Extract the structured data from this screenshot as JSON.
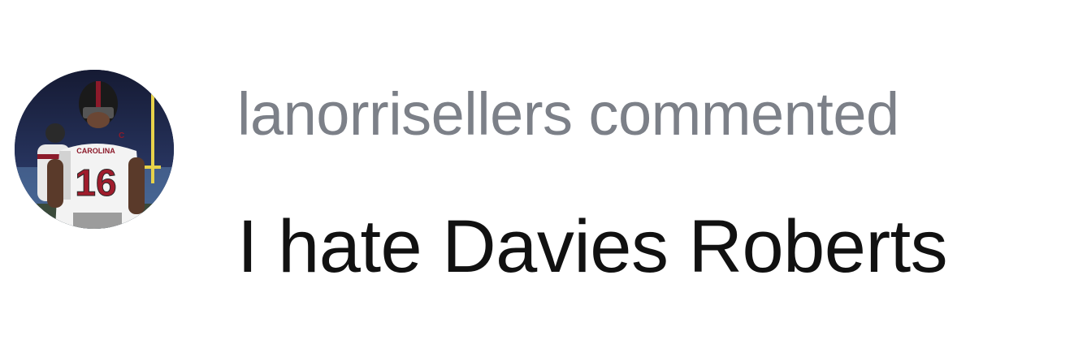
{
  "comment": {
    "username": "lanorrisellers",
    "action": "commented",
    "text": "I hate Davies Roberts",
    "avatar_icon": "user-avatar-photo",
    "jersey_text": "CAROLINA",
    "jersey_number": "16"
  },
  "colors": {
    "header_text": "#7c8088",
    "body_text": "#111111",
    "background": "#ffffff"
  }
}
